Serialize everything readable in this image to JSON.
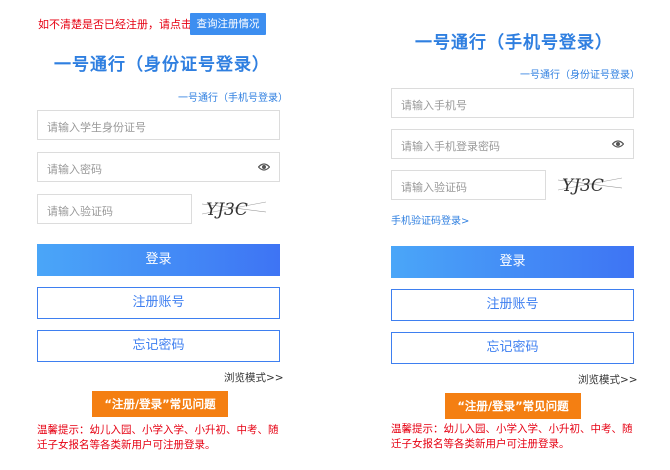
{
  "left": {
    "notice": "如不清楚是否已经注册，请点击：",
    "check_button": "查询注册情况",
    "title": "一号通行（身份证号登录）",
    "switch_link": "一号通行（手机号登录）",
    "id_placeholder": "请输入学生身份证号",
    "password_placeholder": "请输入密码",
    "code_placeholder": "请输入验证码",
    "captcha_text": "YJ3C",
    "login_button": "登录",
    "register_button": "注册账号",
    "forgot_button": "忘记密码",
    "browse_mode": "浏览模式>>",
    "faq_button": "“注册/登录”常见问题",
    "tips": "温馨提示：幼儿入园、小学入学、小升初、中考、随迁子女报名等各类新用户可注册登录。"
  },
  "right": {
    "title": "一号通行（手机号登录）",
    "switch_link": "一号通行（身份证号登录）",
    "phone_placeholder": "请输入手机号",
    "password_placeholder": "请输入手机登录密码",
    "code_placeholder": "请输入验证码",
    "captcha_text": "YJ3C",
    "sms_link": "手机验证码登录>",
    "login_button": "登录",
    "register_button": "注册账号",
    "forgot_button": "忘记密码",
    "browse_mode": "浏览模式>>",
    "faq_button": "“注册/登录”常见问题",
    "tips": "温馨提示：幼儿入园、小学入学、小升初、中考、随迁子女报名等各类新用户可注册登录。"
  },
  "icons": {
    "eye": "eye-icon",
    "captcha": "captcha-image"
  },
  "colors": {
    "accent": "#2f7fe0",
    "notice_red": "#e60012",
    "faq_orange": "#f47f12"
  }
}
